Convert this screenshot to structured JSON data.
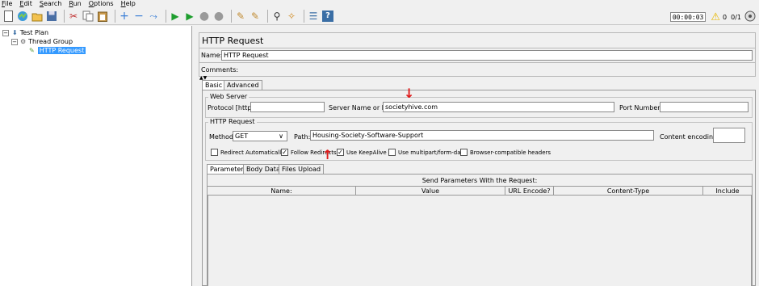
{
  "menu": [
    "File",
    "Edit",
    "Search",
    "Run",
    "Options",
    "Help"
  ],
  "toolbar": {
    "icons": [
      "new-icon",
      "templates-icon",
      "open-icon",
      "save-icon",
      "cut-icon",
      "copy-icon",
      "paste-icon",
      "expand-icon",
      "collapse-icon",
      "toggle-icon",
      "start-icon",
      "start-no-pause-icon",
      "stop-icon",
      "shutdown-icon",
      "clear-icon",
      "clear-all-icon",
      "search-icon",
      "reset-search-icon",
      "function-helper-icon",
      "help-icon"
    ],
    "timer": "00:00:03",
    "warn_count": "0",
    "threads": "0/1"
  },
  "tree": {
    "test_plan": "Test Plan",
    "thread_group": "Thread Group",
    "http_request": "HTTP Request"
  },
  "panel": {
    "title": "HTTP Request",
    "name_label": "Name:",
    "name_value": "HTTP Request",
    "comments_label": "Comments:",
    "tabs": [
      "Basic",
      "Advanced"
    ],
    "web_server": {
      "group": "Web Server",
      "protocol_label": "Protocol [http]:",
      "protocol_value": "",
      "server_label": "Server Name or IP:",
      "server_value": "societyhive.com",
      "port_label": "Port Number:",
      "port_value": ""
    },
    "http_request": {
      "group": "HTTP Request",
      "method_label": "Method:",
      "method_value": "GET",
      "path_label": "Path:",
      "path_value": "Housing-Society-Software-Support",
      "encoding_label": "Content encoding:",
      "encoding_value": ""
    },
    "checkboxes": [
      {
        "label": "Redirect Automatically",
        "checked": false
      },
      {
        "label": "Follow Redirects",
        "checked": true
      },
      {
        "label": "Use KeepAlive",
        "checked": true
      },
      {
        "label": "Use multipart/form-data",
        "checked": false
      },
      {
        "label": "Browser-compatible headers",
        "checked": false
      }
    ],
    "subtabs": [
      "Parameters",
      "Body Data",
      "Files Upload"
    ],
    "params_title": "Send Parameters With the Request:",
    "columns": [
      "Name:",
      "Value",
      "URL Encode?",
      "Content-Type",
      "Include Equals?"
    ]
  }
}
